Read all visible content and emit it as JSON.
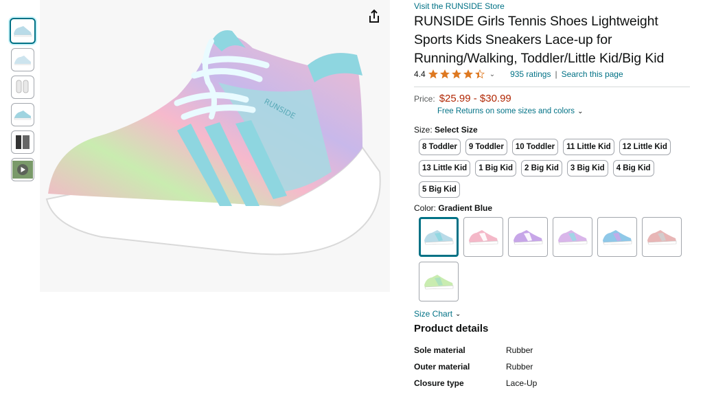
{
  "store_link": "Visit the RUNSIDE Store",
  "title": "RUNSIDE Girls Tennis Shoes Lightweight Sports Kids Sneakers Lace-up for Running/Walking, Toddler/Little Kid/Big Kid",
  "rating": {
    "value": "4.4",
    "stars": 4.4,
    "ratings_count": "935 ratings",
    "separator": "|",
    "search_link": "Search this page"
  },
  "price": {
    "label": "Price:",
    "range": "$25.99 - $30.99",
    "returns": "Free Returns on some sizes and colors"
  },
  "size": {
    "label": "Size:",
    "selected": "Select Size",
    "options": [
      "8 Toddler",
      "9 Toddler",
      "10 Toddler",
      "11 Little Kid",
      "12 Little Kid",
      "13 Little Kid",
      "1 Big Kid",
      "2 Big Kid",
      "3 Big Kid",
      "4 Big Kid",
      "5 Big Kid"
    ]
  },
  "color": {
    "label": "Color:",
    "selected": "Gradient Blue",
    "swatches": [
      {
        "name": "gradient-blue",
        "body": "#b9dbe8",
        "accent": "#8ed6e0"
      },
      {
        "name": "pink",
        "body": "#f4b8c8",
        "accent": "#ffffff"
      },
      {
        "name": "purple",
        "body": "#c7a6e8",
        "accent": "#ffffff"
      },
      {
        "name": "rainbow-purple",
        "body": "#d9b6ea",
        "accent": "#9ad8e6"
      },
      {
        "name": "blue-rainbow",
        "body": "#8fc8e8",
        "accent": "#c6a8e8"
      },
      {
        "name": "pink-grey",
        "body": "#e8b6b6",
        "accent": "#cfcfcf"
      },
      {
        "name": "green",
        "body": "#c9ecb0",
        "accent": "#a8e0c0"
      }
    ]
  },
  "size_chart": "Size Chart",
  "product_details": {
    "title": "Product details",
    "rows": [
      {
        "key": "Sole material",
        "value": "Rubber"
      },
      {
        "key": "Outer material",
        "value": "Rubber"
      },
      {
        "key": "Closure type",
        "value": "Lace-Up"
      }
    ]
  },
  "colors": {
    "link": "#007185",
    "price": "#b12704",
    "star": "#de7921",
    "selected_border": "#007185"
  }
}
